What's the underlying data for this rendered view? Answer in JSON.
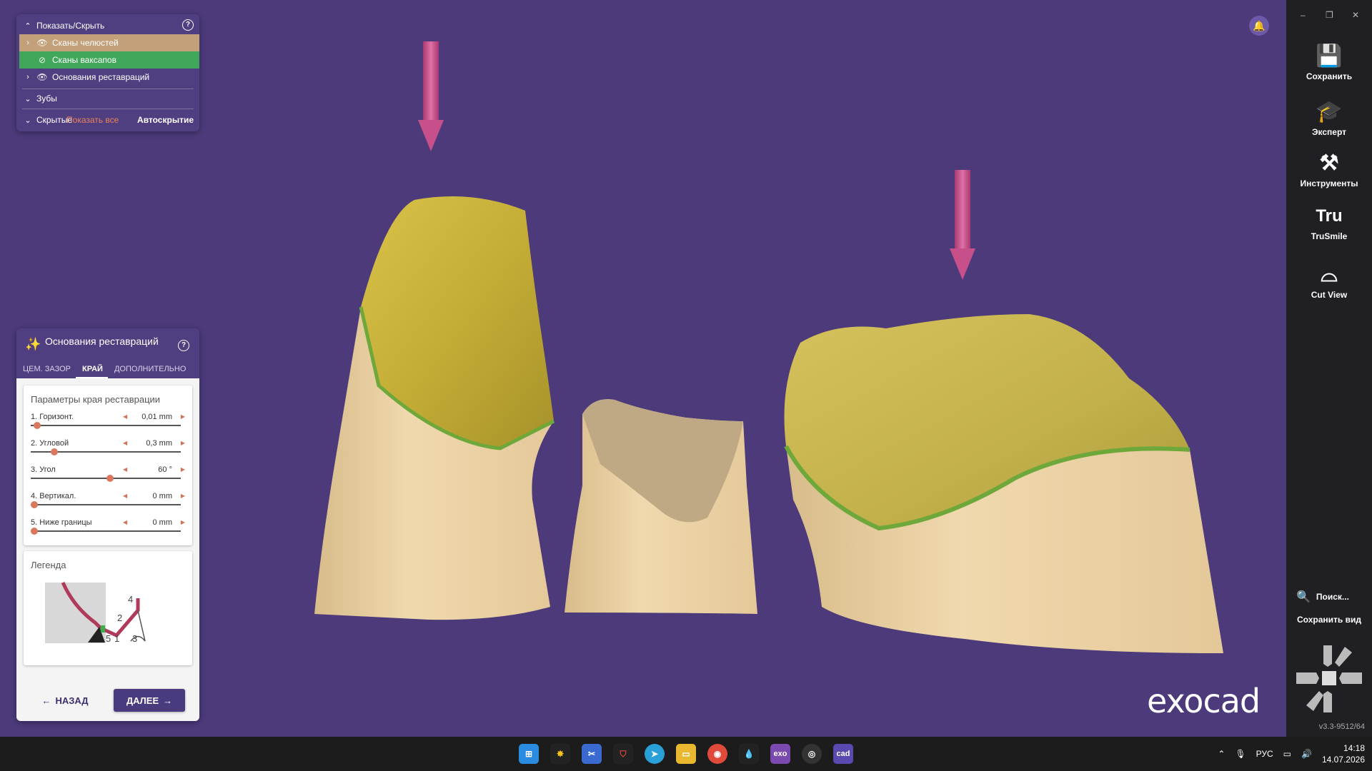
{
  "showhide": {
    "title": "Показать/Скрыть",
    "items": [
      {
        "label": "Сканы челюстей"
      },
      {
        "label": "Сканы ваксапов"
      },
      {
        "label": "Основания реставраций"
      }
    ],
    "teeth": "Зубы",
    "hidden": "Скрытые",
    "show_all": "Показать все",
    "autohide": "Автоскрытие",
    "help": "?"
  },
  "restoration": {
    "title": "Основания реставраций",
    "help": "?",
    "tabs": [
      "ЦЕМ. ЗАЗОР",
      "КРАЙ",
      "ДОПОЛНИТЕЛЬНО"
    ],
    "active_tab": "КРАЙ",
    "params_title": "Параметры края реставрации",
    "params": [
      {
        "label": "1. Горизонт.",
        "value": "0,01 mm",
        "level": 0.02
      },
      {
        "label": "2. Угловой",
        "value": "0,3 mm",
        "level": 0.14
      },
      {
        "label": "3. Угол",
        "value": "60 °",
        "level": 0.53
      },
      {
        "label": "4. Вертикал.",
        "value": "0 mm",
        "level": 0.0
      },
      {
        "label": "5. Ниже границы",
        "value": "0 mm",
        "level": 0.0
      }
    ],
    "legend_title": "Легенда",
    "legend_numbers": [
      "4",
      "2",
      "5",
      "1",
      "3"
    ],
    "back": "НАЗАД",
    "next": "ДАЛЕЕ"
  },
  "sidebar": {
    "buttons": [
      {
        "label": "Сохранить",
        "icon": "save-icon"
      },
      {
        "label": "Эксперт",
        "icon": "graduation-cap-icon"
      },
      {
        "label": "Инструменты",
        "icon": "tools-icon"
      },
      {
        "label": "TruSmile",
        "icon": "trusmile-icon",
        "glyph": "Tru"
      },
      {
        "label": "Cut View",
        "icon": "cut-view-icon"
      }
    ],
    "search": "Поиск...",
    "save_view": "Сохранить вид",
    "version": "v3.3-9512/64"
  },
  "brand": "exocad",
  "taskbar": {
    "icons": [
      "windows-start-icon",
      "photo-icon",
      "snipping-icon",
      "shield-app-icon",
      "telegram-icon",
      "file-explorer-icon",
      "chrome-icon",
      "color-app-icon",
      "exo-app-icon",
      "camera-app-icon",
      "cad-app-icon"
    ],
    "exo_label": "exo",
    "cad_label": "cad",
    "lang": "РУС",
    "time": "14:18",
    "date": "14.07.2026"
  },
  "colors": {
    "background": "#4c3a7a",
    "panel": "#4f3f80",
    "jaw_row": "#c2a07a",
    "wax_row": "#40a85a",
    "accent_knob": "#d9785f",
    "tooth_base": "#e8cfa0",
    "crown": "#c7b23a",
    "margin_line": "#6fa83a",
    "arrow": "#c8508a"
  }
}
